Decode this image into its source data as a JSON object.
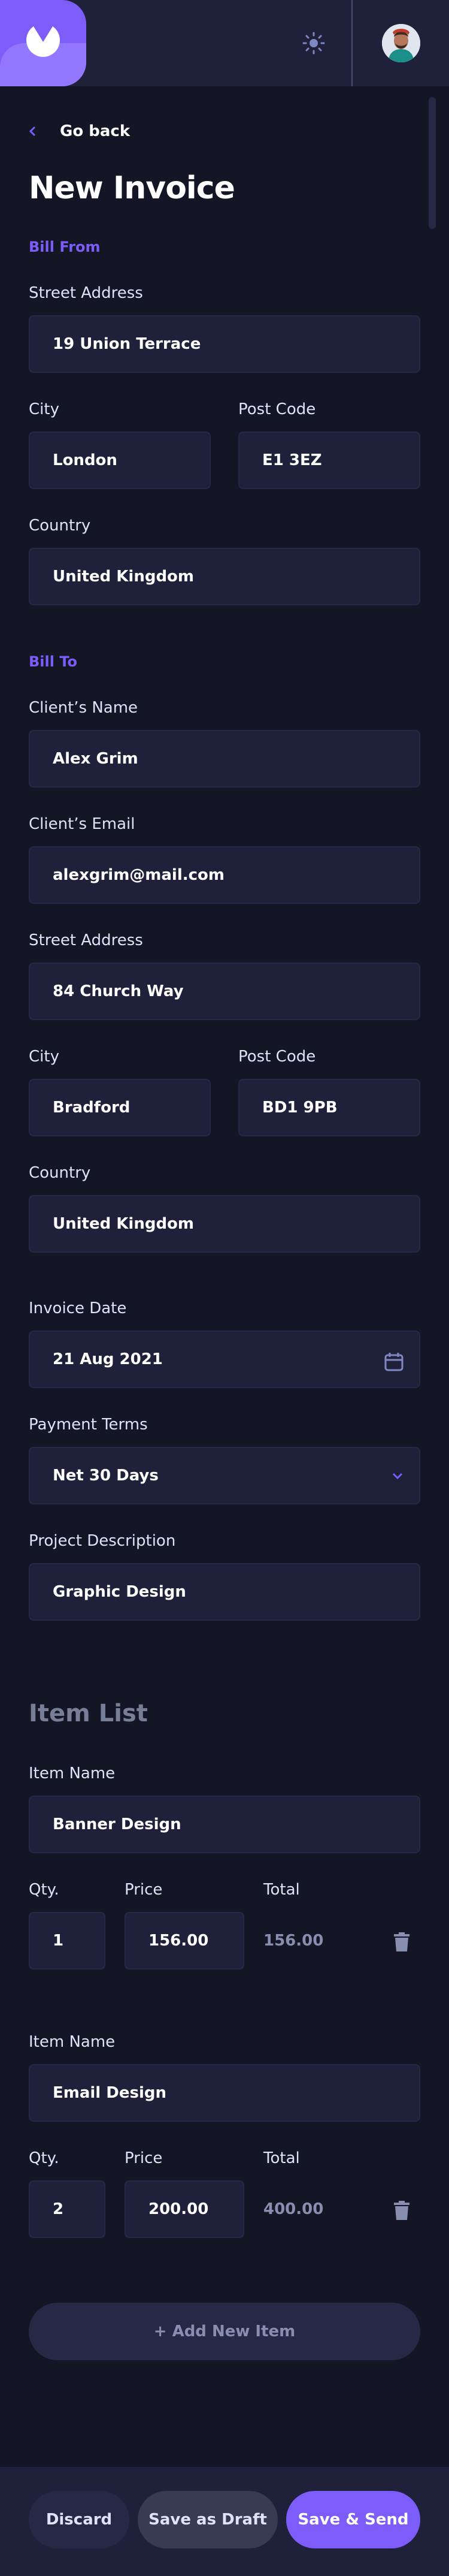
{
  "nav": {
    "go_back_label": "Go back"
  },
  "page": {
    "title": "New Invoice"
  },
  "bill_from": {
    "section_title": "Bill From",
    "street_label": "Street Address",
    "street_value": "19 Union Terrace",
    "city_label": "City",
    "city_value": "London",
    "postcode_label": "Post Code",
    "postcode_value": "E1 3EZ",
    "country_label": "Country",
    "country_value": "United Kingdom"
  },
  "bill_to": {
    "section_title": "Bill To",
    "client_name_label": "Client’s Name",
    "client_name_value": "Alex Grim",
    "client_email_label": "Client’s Email",
    "client_email_value": "alexgrim@mail.com",
    "street_label": "Street Address",
    "street_value": "84 Church Way",
    "city_label": "City",
    "city_value": "Bradford",
    "postcode_label": "Post Code",
    "postcode_value": "BD1 9PB",
    "country_label": "Country",
    "country_value": "United Kingdom"
  },
  "invoice": {
    "date_label": "Invoice Date",
    "date_value": "21 Aug 2021",
    "terms_label": "Payment Terms",
    "terms_value": "Net 30 Days",
    "description_label": "Project Description",
    "description_value": "Graphic Design"
  },
  "items": {
    "title": "Item List",
    "name_label": "Item Name",
    "qty_label": "Qty.",
    "price_label": "Price",
    "total_label": "Total",
    "rows": [
      {
        "name": "Banner Design",
        "qty": "1",
        "price": "156.00",
        "total": "156.00"
      },
      {
        "name": "Email Design",
        "qty": "2",
        "price": "200.00",
        "total": "400.00"
      }
    ],
    "add_label": "+ Add New Item"
  },
  "actions": {
    "discard": "Discard",
    "save_draft": "Save as Draft",
    "save_send": "Save & Send"
  },
  "colors": {
    "background": "#141625",
    "surface": "#1e2139",
    "accent": "#7c5dfa",
    "muted": "#888eb0"
  },
  "icons": {
    "theme_toggle": "sun-icon",
    "back": "chevron-left-icon",
    "date": "calendar-icon",
    "terms": "chevron-down-icon",
    "delete": "trash-icon"
  }
}
